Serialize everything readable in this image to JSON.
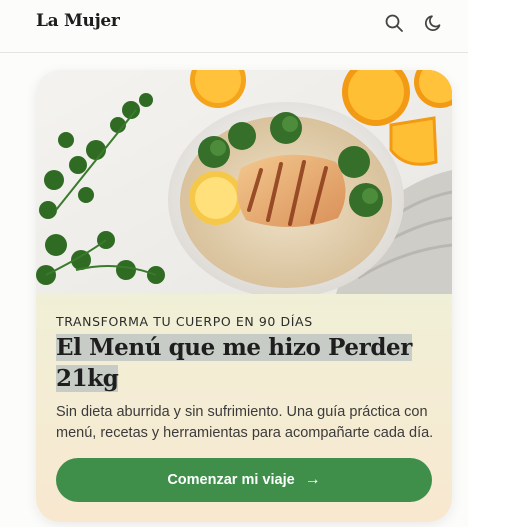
{
  "header": {
    "brand": "La Mujer",
    "search_icon": "search-icon",
    "theme_icon": "moon-icon"
  },
  "hero": {
    "eyebrow": "TRANSFORMA TU CUERPO EN 90 DÍAS",
    "title_line1": "El Menú que me hizo Perder",
    "title_line2": "21kg",
    "subtitle": "Sin dieta aburrida y sin sufrimiento. Una guía práctica con menú, recetas y herramientas para acompañarte cada día.",
    "cta_label": "Comenzar mi viaje",
    "cta_icon": "arrow-right-icon"
  },
  "colors": {
    "accent": "#3f8f4b",
    "text": "#1e1e1e",
    "highlight": "#c8ccc7"
  }
}
